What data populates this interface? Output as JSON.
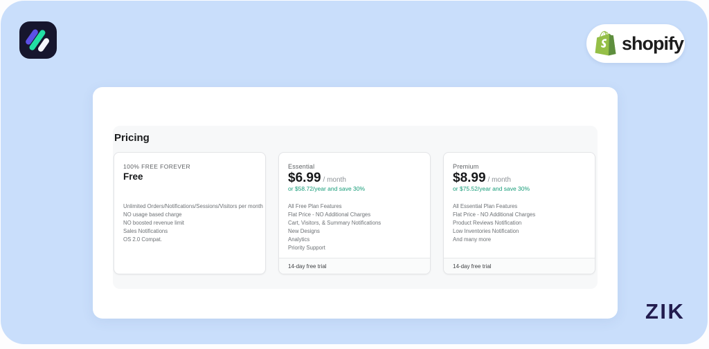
{
  "colors": {
    "background_blue": "#c9defb",
    "accent_green": "#149b77",
    "shopify_green": "#95bf47",
    "shopify_green_dark": "#5e8e3e",
    "logo_navy": "#16162d"
  },
  "header": {
    "shopify_wordmark": "shopify"
  },
  "pricing": {
    "title": "Pricing",
    "plans": [
      {
        "label": "100% FREE FOREVER",
        "headline": "Free",
        "period": "",
        "yearly_note": "",
        "features": [
          "Unlimited Orders/Notifications/Sessions/Visitors per month",
          "NO usage based charge",
          "NO boosted revenue limit",
          "Sales Notifications",
          "OS 2.0 Compat."
        ],
        "trial": ""
      },
      {
        "label": "Essential",
        "headline": "$6.99",
        "period": "/ month",
        "yearly_note": "or $58.72/year and save 30%",
        "features": [
          "All Free Plan Features",
          "Flat Price - NO Additional Charges",
          "Cart, Visitors, & Summary Notifications",
          "New Designs",
          "Analytics",
          "Priority Support"
        ],
        "trial": "14-day free trial"
      },
      {
        "label": "Premium",
        "headline": "$8.99",
        "period": "/ month",
        "yearly_note": "or $75.52/year and save 30%",
        "features": [
          "All Essential Plan Features",
          "Flat Price - NO Additional Charges",
          "Product Reviews Notification",
          "Low Inventories Notification",
          "And many more"
        ],
        "trial": "14-day free trial"
      }
    ]
  },
  "footer": {
    "watermark": "ZIK"
  }
}
